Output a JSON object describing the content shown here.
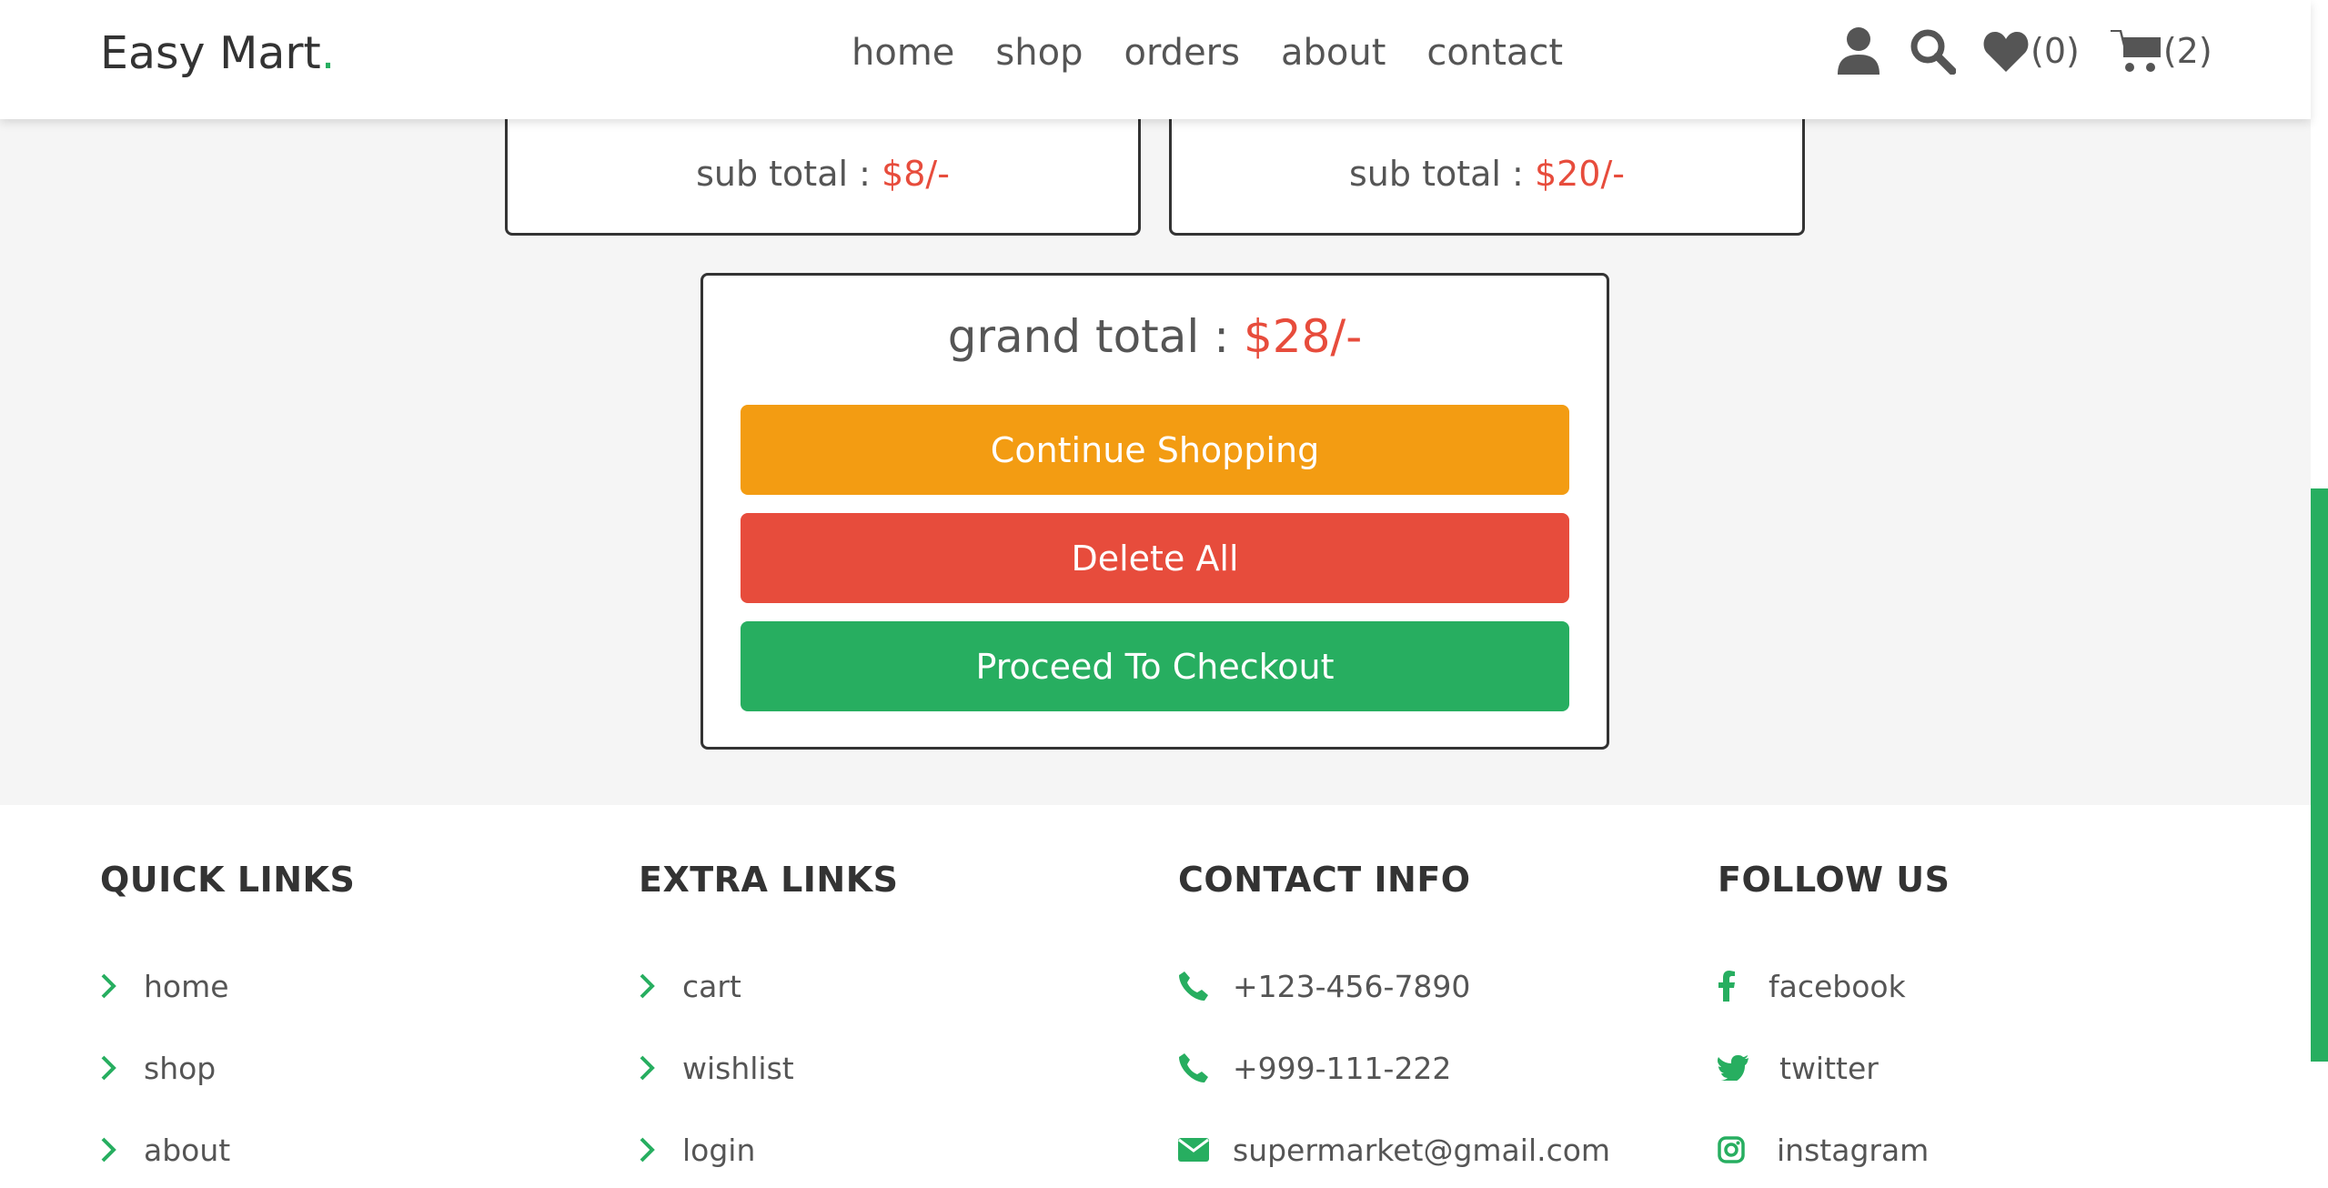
{
  "header": {
    "logo_text": "Easy Mart",
    "logo_dot": ".",
    "nav": [
      "home",
      "shop",
      "orders",
      "about",
      "contact"
    ],
    "wishlist_count": "(0)",
    "cart_count": "(2)",
    "icons": [
      "user-icon",
      "search-icon",
      "heart-icon",
      "cart-icon"
    ]
  },
  "cart": {
    "boxes": [
      {
        "label": "sub total :",
        "amount": "$8/-"
      },
      {
        "label": "sub total :",
        "amount": "$20/-"
      }
    ],
    "grand_total_label": "grand total :",
    "grand_total_amount": "$28/-",
    "buttons": {
      "continue": "Continue Shopping",
      "delete_all": "Delete All",
      "checkout": "Proceed To Checkout"
    }
  },
  "footer": {
    "quick_links": {
      "title": "QUICK LINKS",
      "items": [
        "home",
        "shop",
        "about"
      ]
    },
    "extra_links": {
      "title": "EXTRA LINKS",
      "items": [
        "cart",
        "wishlist",
        "login"
      ]
    },
    "contact_info": {
      "title": "CONTACT INFO",
      "items": [
        "+123-456-7890",
        "+999-111-222",
        "supermarket@gmail.com"
      ]
    },
    "follow_us": {
      "title": "FOLLOW US",
      "items": [
        "facebook",
        "twitter",
        "instagram"
      ]
    }
  },
  "colors": {
    "accent": "#27ae60",
    "danger": "#e74c3c",
    "warning": "#f39c12"
  }
}
